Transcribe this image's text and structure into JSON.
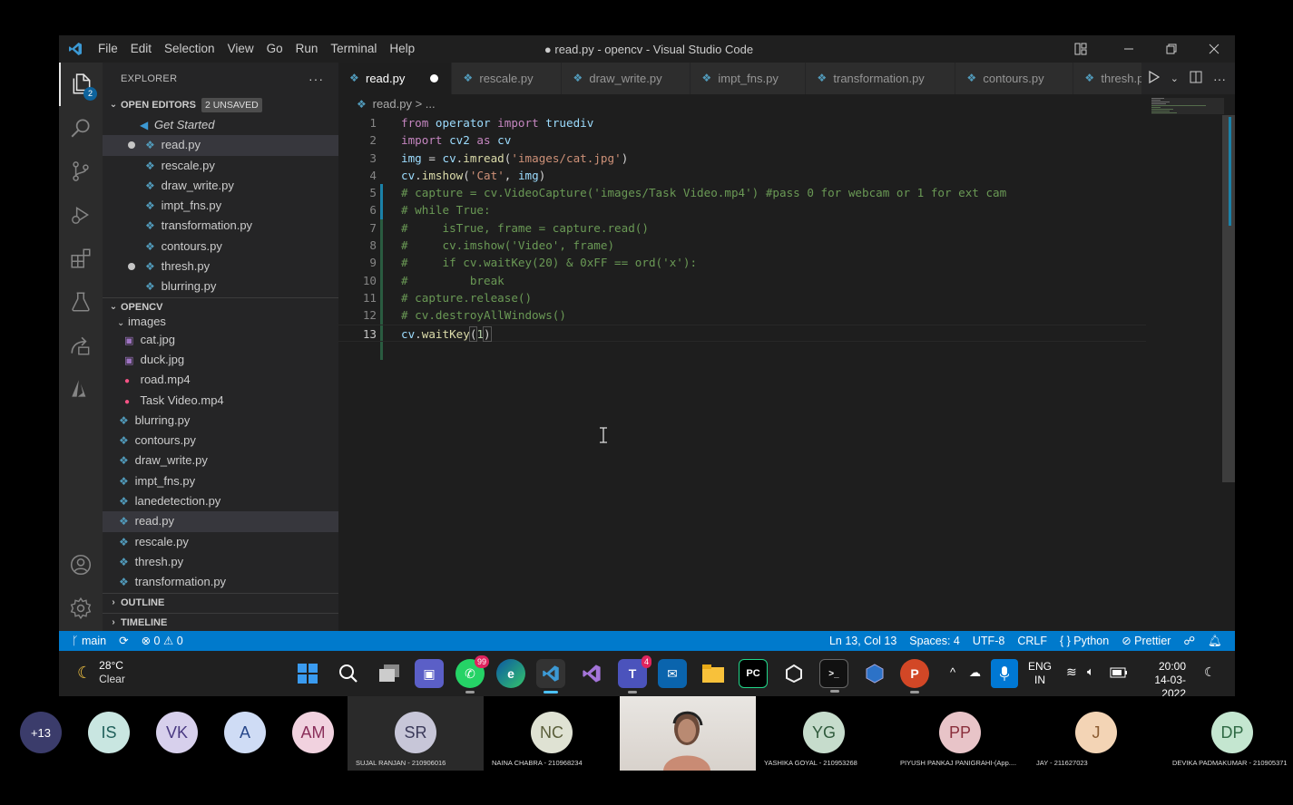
{
  "titlebar": {
    "menus": [
      "File",
      "Edit",
      "Selection",
      "View",
      "Go",
      "Run",
      "Terminal",
      "Help"
    ],
    "window_title": "● read.py - opencv - Visual Studio Code"
  },
  "activitybar": {
    "explorer_badge": "2"
  },
  "sidebar": {
    "title": "EXPLORER",
    "more": "···",
    "open_editors": {
      "label": "OPEN EDITORS",
      "badge": "2 UNSAVED",
      "items": [
        "Get Started",
        "read.py",
        "rescale.py",
        "draw_write.py",
        "impt_fns.py",
        "transformation.py",
        "contours.py",
        "thresh.py",
        "blurring.py"
      ]
    },
    "folder": {
      "label": "OPENCV",
      "subfolder": "images",
      "image_files": [
        "cat.jpg",
        "duck.jpg"
      ],
      "video_files": [
        "road.mp4",
        "Task Video.mp4"
      ],
      "files": [
        "blurring.py",
        "contours.py",
        "draw_write.py",
        "impt_fns.py",
        "lanedetection.py",
        "read.py",
        "rescale.py",
        "thresh.py",
        "transformation.py"
      ]
    },
    "outline": "OUTLINE",
    "timeline": "TIMELINE"
  },
  "tabs": [
    "read.py",
    "rescale.py",
    "draw_write.py",
    "impt_fns.py",
    "transformation.py",
    "contours.py",
    "thresh.p"
  ],
  "breadcrumb": "read.py > ...",
  "code": {
    "line_numbers": [
      "1",
      "2",
      "3",
      "4",
      "5",
      "6",
      "7",
      "8",
      "9",
      "10",
      "11",
      "12",
      "13"
    ],
    "l1": [
      "from",
      " operator ",
      "import",
      " truediv"
    ],
    "l2": [
      "import",
      " cv2 ",
      "as",
      " cv"
    ],
    "l3": [
      "img",
      " = ",
      "cv",
      ".",
      "imread",
      "(",
      "'images/cat.jpg'",
      ")"
    ],
    "l4": [
      "cv",
      ".",
      "imshow",
      "(",
      "'Cat'",
      ", ",
      "img",
      ")"
    ],
    "l5": "# capture = cv.VideoCapture('images/Task Video.mp4') #pass 0 for webcam or 1 for ext cam",
    "l6": "# while True:",
    "l7": "#     isTrue, frame = capture.read()",
    "l8": "#     cv.imshow('Video', frame)",
    "l9": "#     if cv.waitKey(20) & 0xFF == ord('x'):",
    "l10": "#         break",
    "l11": "# capture.release()",
    "l12": "# cv.destroyAllWindows()",
    "l13": [
      "cv",
      ".",
      "waitKey",
      "(",
      "1",
      ")"
    ]
  },
  "statusbar": {
    "branch": "main",
    "errors": "0",
    "warnings": "0",
    "position": "Ln 13, Col 13",
    "spaces": "Spaces: 4",
    "encoding": "UTF-8",
    "eol": "CRLF",
    "language": "{ } Python",
    "formatter": "Prettier"
  },
  "taskbar": {
    "temperature": "28°C",
    "weather": "Clear",
    "whatsapp_badge": "99",
    "teams_badge": "4",
    "lang": "ENG",
    "region": "IN",
    "time": "20:00",
    "date": "14-03-2022"
  },
  "meeting": {
    "more_count": "+13",
    "small": [
      "IS",
      "VK",
      "A",
      "AM"
    ],
    "tiles": [
      {
        "initials": "SR",
        "name": "SUJAL RANJAN - 210906016",
        "color": "#c7c6d8"
      },
      {
        "initials": "NC",
        "name": "NAINA CHABRA - 210968234",
        "color": "#c9d3c3"
      },
      {
        "initials": "YG",
        "name": "YASHIKA GOYAL - 210953268",
        "color": "#c6dccc"
      },
      {
        "initials": "PP",
        "name": "PIYUSH PANKAJ PANIGRAHI-(App....",
        "color": "#e8c4c8"
      },
      {
        "initials": "J",
        "name": "JAY - 211627023",
        "color": "#f3d4b5"
      },
      {
        "initials": "DP",
        "name": "DEVIKA PADMAKUMAR - 210905371",
        "color": "#c4e6d0"
      }
    ]
  }
}
